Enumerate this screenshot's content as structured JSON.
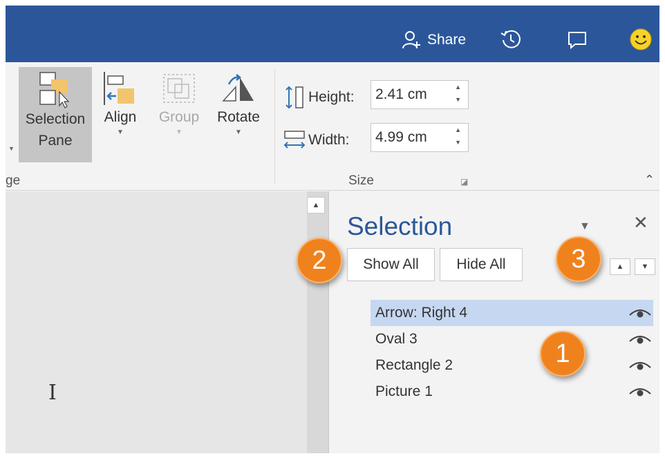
{
  "titlebar": {
    "share_label": "Share",
    "icons": [
      "share-person-icon",
      "history-icon",
      "comment-icon",
      "smiley-icon"
    ],
    "bg_color": "#2b579a"
  },
  "ribbon": {
    "arrange_group_label": "ge",
    "buttons": {
      "selection_pane": "Selection Pane",
      "align": "Align",
      "group": "Group",
      "rotate": "Rotate"
    },
    "size": {
      "group_label": "Size",
      "height_label": "Height:",
      "height_value": "2.41 cm",
      "width_label": "Width:",
      "width_value": "4.99 cm"
    }
  },
  "selection_pane": {
    "title": "Selection",
    "show_all": "Show All",
    "hide_all": "Hide All",
    "items": [
      {
        "label": "Arrow: Right 4",
        "selected": true
      },
      {
        "label": "Oval 3",
        "selected": false
      },
      {
        "label": "Rectangle 2",
        "selected": false
      },
      {
        "label": "Picture 1",
        "selected": false
      }
    ],
    "accent_color": "#2b579a",
    "selected_color": "#c6d8f1"
  },
  "callouts": [
    "1",
    "2",
    "3"
  ],
  "callout_color": "#f0821e"
}
